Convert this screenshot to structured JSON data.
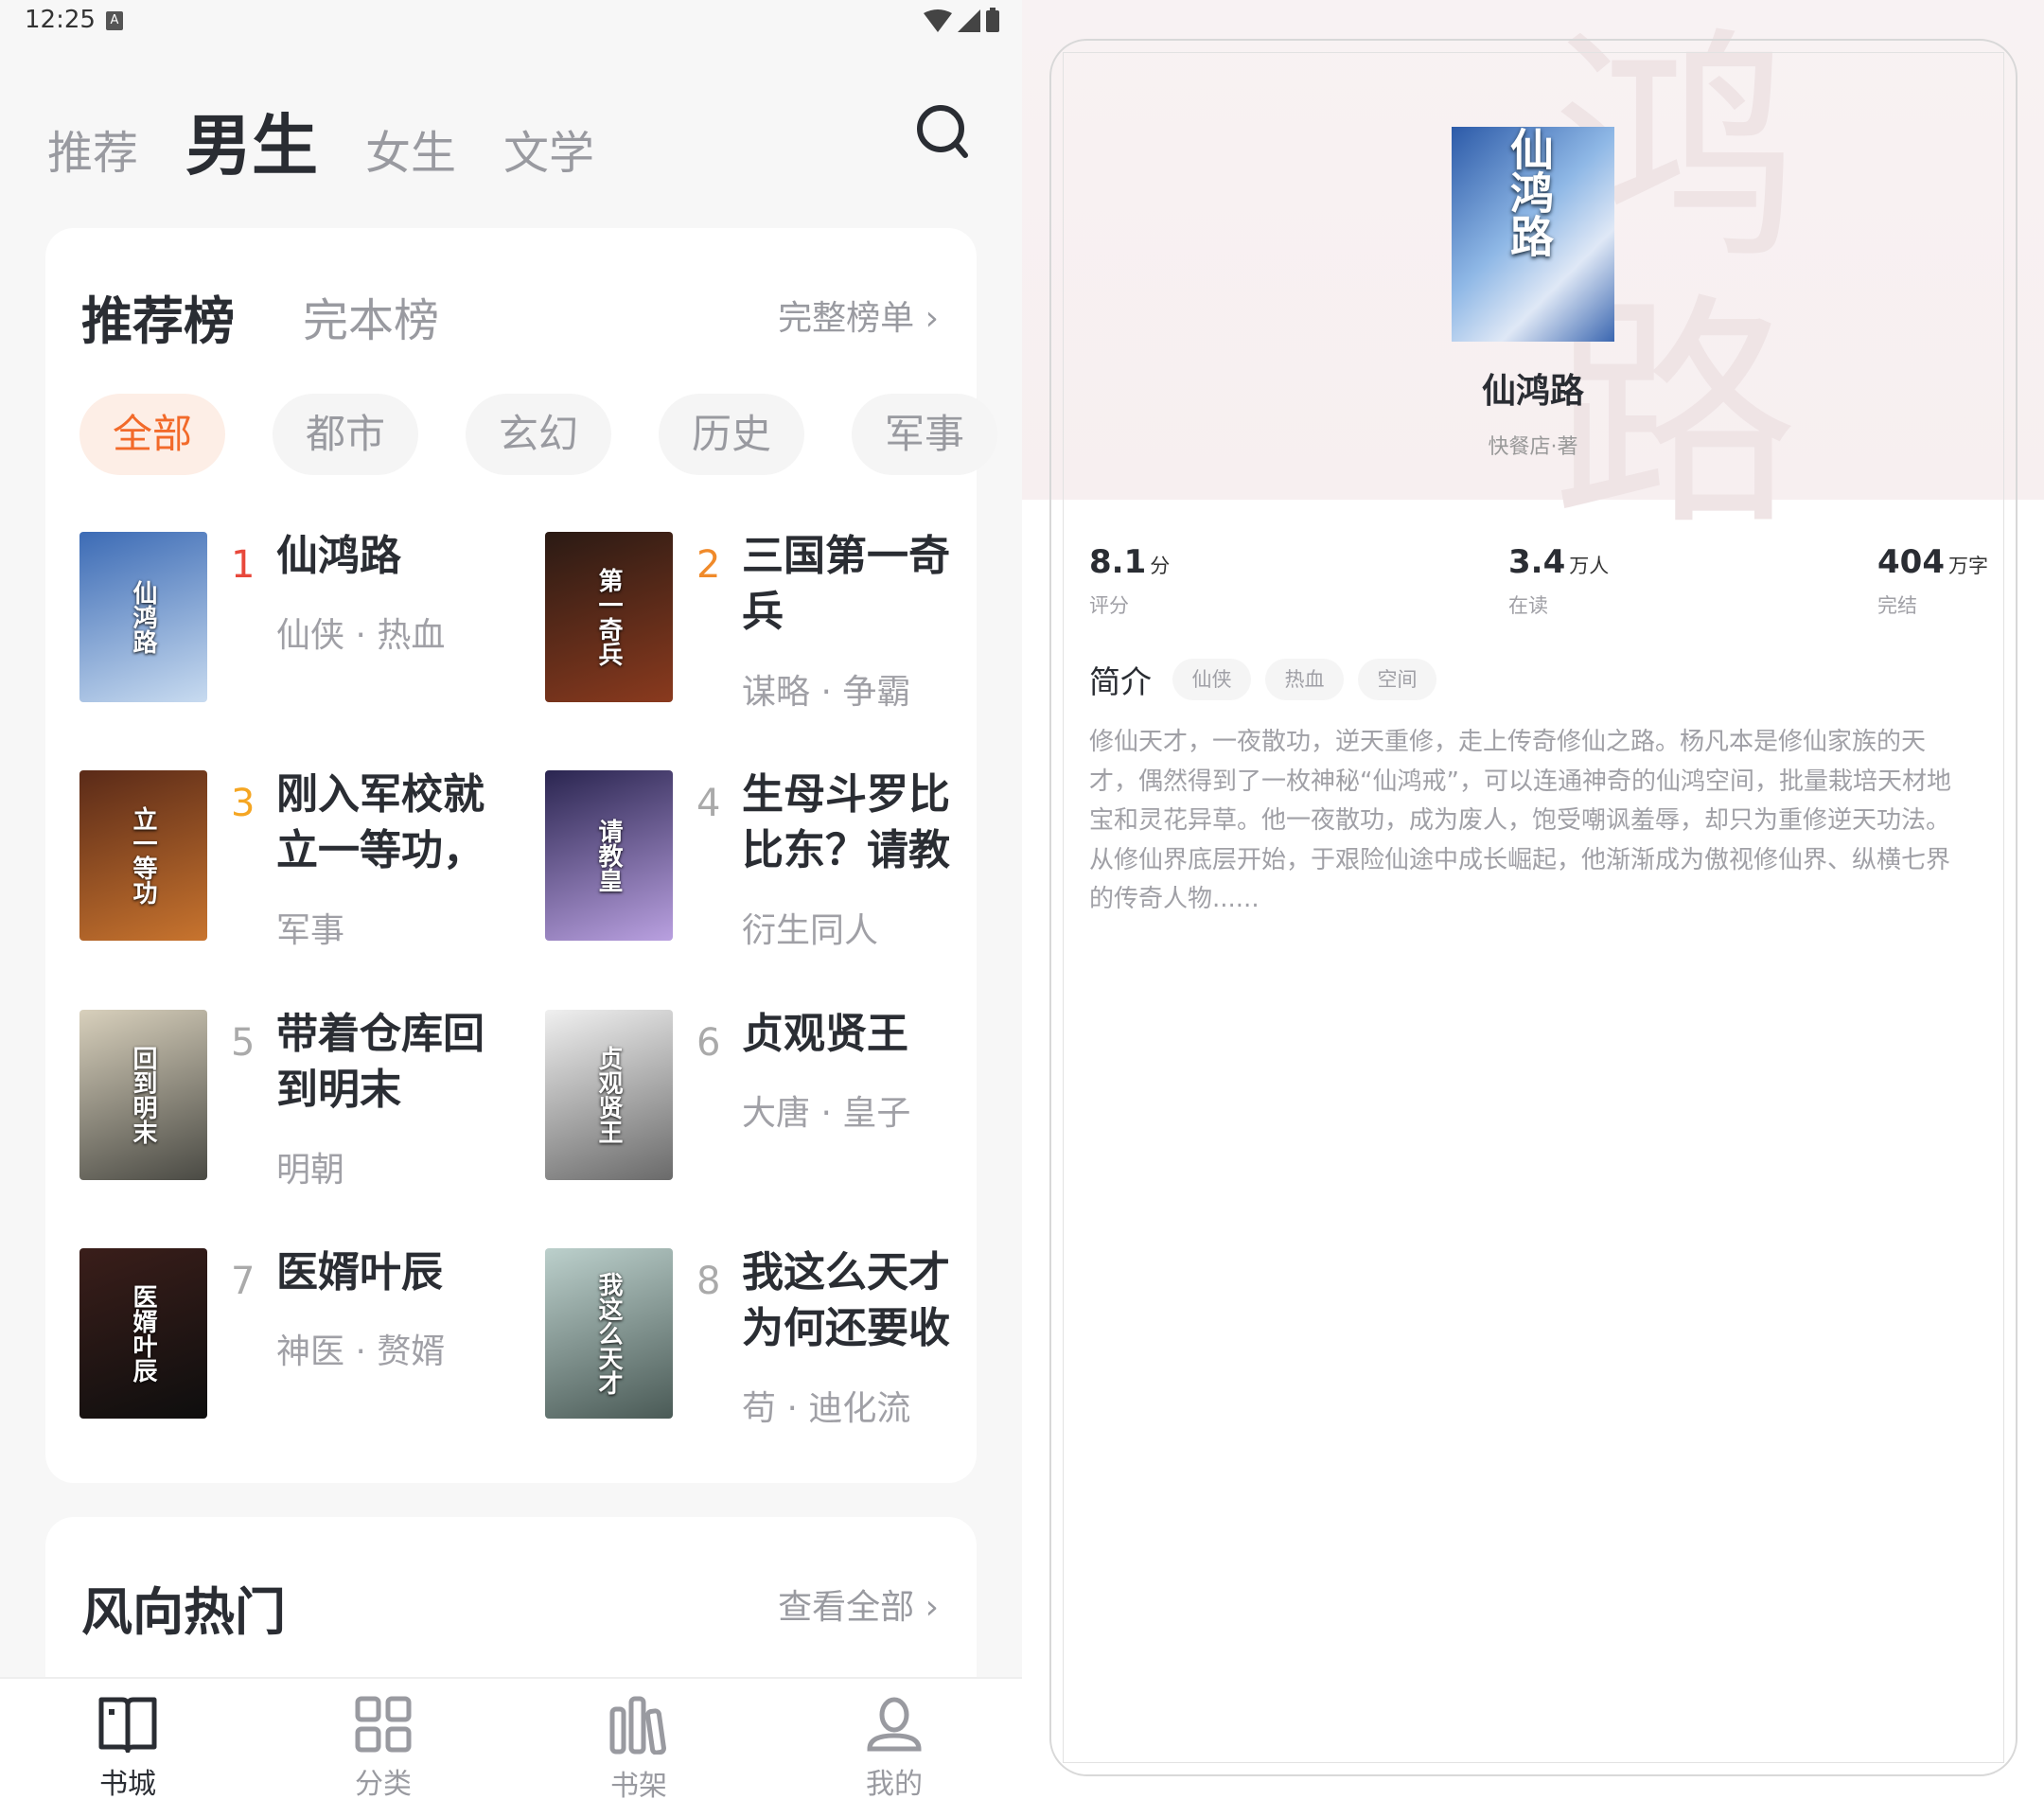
{
  "status_bar": {
    "time": "12:25",
    "notification": "A"
  },
  "top_tabs": [
    {
      "label": "推荐"
    },
    {
      "label": "男生",
      "active": true
    },
    {
      "label": "女生"
    },
    {
      "label": "文学"
    }
  ],
  "ranking": {
    "tabs": [
      "推荐榜",
      "完本榜"
    ],
    "more": "完整榜单",
    "chips": [
      {
        "label": "全部",
        "active": true
      },
      {
        "label": "都市"
      },
      {
        "label": "玄幻"
      },
      {
        "label": "历史"
      },
      {
        "label": "军事"
      }
    ],
    "books": [
      {
        "rank": "1",
        "title": "仙鸿路",
        "tags": "仙侠 · 热血",
        "rank_color": "#e8483b",
        "cover_colors": [
          "#3c6bb5",
          "#c8dbf0"
        ]
      },
      {
        "rank": "2",
        "title": "三国第一奇兵",
        "tags": "谋略 · 争霸",
        "rank_color": "#f08a2a",
        "cover_colors": [
          "#2a1a14",
          "#8a3a1e"
        ]
      },
      {
        "rank": "3",
        "title": "刚入军校就立一等功，",
        "tags": "军事",
        "rank_color": "#f5a623",
        "cover_colors": [
          "#5a2a18",
          "#c8742e"
        ]
      },
      {
        "rank": "4",
        "title": "生母斗罗比比东？请教",
        "tags": "衍生同人",
        "rank_color": "#aaaaaa",
        "cover_colors": [
          "#2a2550",
          "#b9a0e0"
        ]
      },
      {
        "rank": "5",
        "title": "带着仓库回到明末",
        "tags": "明朝",
        "rank_color": "#aaaaaa",
        "cover_colors": [
          "#d8d0bc",
          "#4a4a44"
        ]
      },
      {
        "rank": "6",
        "title": "贞观贤王",
        "tags": "大唐 · 皇子",
        "rank_color": "#aaaaaa",
        "cover_colors": [
          "#f0f0f0",
          "#6a6a6a"
        ]
      },
      {
        "rank": "7",
        "title": "医婿叶辰",
        "tags": "神医 · 赘婿",
        "rank_color": "#aaaaaa",
        "cover_colors": [
          "#3a1e1a",
          "#0e0e0e"
        ]
      },
      {
        "rank": "8",
        "title": "我这么天才为何还要收",
        "tags": "苟 · 迪化流",
        "rank_color": "#aaaaaa",
        "cover_colors": [
          "#bcd0cc",
          "#4a5a56"
        ]
      }
    ],
    "cover_texts": [
      "仙鸿路",
      "第一奇兵",
      "立一等功",
      "请教皇",
      "回到明末",
      "贞观贤王",
      "医婿叶辰",
      "我这么天才"
    ]
  },
  "hot": {
    "title": "风向热门",
    "more": "查看全部"
  },
  "bottom_nav": [
    {
      "label": "书城",
      "icon": "book-open-icon",
      "active": true
    },
    {
      "label": "分类",
      "icon": "grid-icon"
    },
    {
      "label": "书架",
      "icon": "bookshelf-icon"
    },
    {
      "label": "我的",
      "icon": "user-icon"
    }
  ],
  "detail": {
    "cover_text": "仙鸿路",
    "title": "仙鸿路",
    "author": "快餐店·著",
    "stats": [
      {
        "value": "8.1",
        "unit": "分",
        "label": "评分"
      },
      {
        "value": "3.4",
        "unit": "万人",
        "label": "在读"
      },
      {
        "value": "404",
        "unit": "万字",
        "label": "完结"
      }
    ],
    "intro_title": "简介",
    "tags": [
      "仙侠",
      "热血",
      "空间"
    ],
    "description": "修仙天才，一夜散功，逆天重修，走上传奇修仙之路。杨凡本是修仙家族的天才，偶然得到了一枚神秘“仙鸿戒”，可以连通神奇的仙鸿空间，批量栽培天材地宝和灵花异草。他一夜散功，成为废人，饱受嘲讽羞辱，却只为重修逆天功法。从修仙界底层开始，于艰险仙途中成长崛起，他渐渐成为傲视修仙界、纵横七界的传奇人物......"
  },
  "colors": {
    "accent": "#f26a2a",
    "chip_active_bg": "#fdeee6",
    "text_dark": "#2a2d33",
    "text_gray": "#999aa0"
  }
}
